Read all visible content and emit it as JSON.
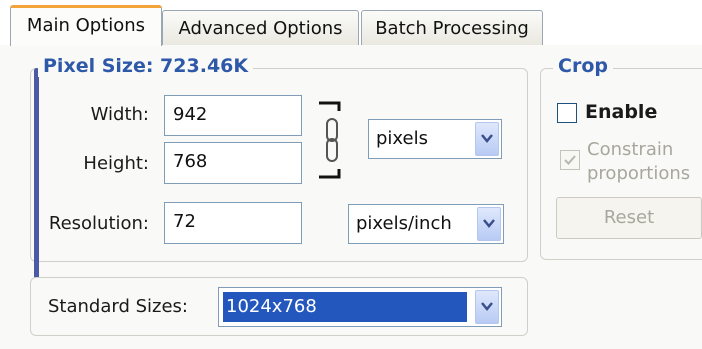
{
  "tabs": [
    {
      "label": "Main Options",
      "active": true
    },
    {
      "label": "Advanced Options",
      "active": false
    },
    {
      "label": "Batch Processing",
      "active": false
    }
  ],
  "pixel_size": {
    "legend": "Pixel Size: 723.46K",
    "width_label": "Width:",
    "width_value": "942",
    "height_label": "Height:",
    "height_value": "768",
    "size_unit": "pixels",
    "constrain_icon": "chain-link-icon",
    "resolution_label": "Resolution:",
    "resolution_value": "72",
    "resolution_unit": "pixels/inch"
  },
  "standard_sizes": {
    "label": "Standard Sizes:",
    "value": "1024x768"
  },
  "crop": {
    "legend": "Crop",
    "enable_label": "Enable",
    "enable_checked": false,
    "constrain_label_line1": "Constrain",
    "constrain_label_line2": "proportions",
    "constrain_checked": true,
    "constrain_disabled": true,
    "reset_label": "Reset",
    "reset_disabled": true
  },
  "colors": {
    "legend_blue": "#2e58a8",
    "active_tab_accent": "#f2a33a",
    "selection_blue": "#2457bd",
    "group_accent": "#4c5aa6"
  }
}
